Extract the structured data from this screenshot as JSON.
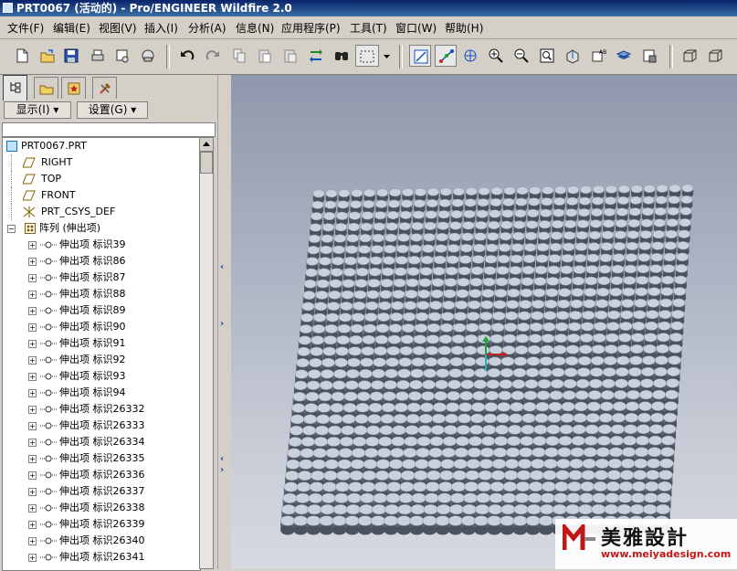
{
  "window": {
    "title": "PRT0067 (活动的) - Pro/ENGINEER Wildfire 2.0"
  },
  "menu": [
    "文件(F)",
    "编辑(E)",
    "视图(V)",
    "插入(I)",
    "分析(A)",
    "信息(N)",
    "应用程序(P)",
    "工具(T)",
    "窗口(W)",
    "帮助(H)"
  ],
  "toolbar_icons": [
    "new-icon",
    "open-icon",
    "save-icon",
    "print-icon",
    "send-icon",
    "mail-icon",
    "undo-icon",
    "redo-icon",
    "copy-icon",
    "paste-icon",
    "paste-special-icon",
    "regenerate-icon",
    "find-icon",
    "select-box-icon",
    "dropdown-icon",
    "datum-plane-icon",
    "datum-axis-icon",
    "datum-point-icon",
    "zoom-in-icon",
    "zoom-out-icon",
    "refit-icon",
    "orient-icon",
    "saved-views-icon",
    "layers-icon",
    "model-setup-icon",
    "view-wireframe-icon",
    "view-hidden-icon"
  ],
  "left_tabs": [
    "model-tree-icon",
    "folder-icon",
    "favorites-icon",
    "tools-icon"
  ],
  "dropdowns": {
    "show": "显示(I)",
    "settings": "设置(G)"
  },
  "tree": {
    "root": "PRT0067.PRT",
    "datums": [
      {
        "label": "RIGHT",
        "icon": "datum-plane-icon"
      },
      {
        "label": "TOP",
        "icon": "datum-plane-icon"
      },
      {
        "label": "FRONT",
        "icon": "datum-plane-icon"
      },
      {
        "label": "PRT_CSYS_DEF",
        "icon": "csys-icon"
      }
    ],
    "pattern": "阵列 (伸出项)",
    "items": [
      "伸出项 标识39",
      "伸出项 标识86",
      "伸出项 标识87",
      "伸出项 标识88",
      "伸出项 标识89",
      "伸出项 标识90",
      "伸出项 标识91",
      "伸出项 标识92",
      "伸出项 标识93",
      "伸出项 标识94",
      "伸出项 标识26332",
      "伸出项 标识26333",
      "伸出项 标识26334",
      "伸出项 标识26335",
      "伸出项 标识26336",
      "伸出项 标识26337",
      "伸出项 标识26338",
      "伸出项 标识26339",
      "伸出项 标识26340",
      "伸出项 标识26341"
    ]
  },
  "watermark": {
    "title": "美雅設計",
    "url": "www.meiyadesign.com"
  },
  "colors": {
    "titlebar": "#0a246a",
    "viewport_top": "#8f97ac",
    "viewport_bottom": "#d6d9e0",
    "cylinder": "#c9d2dc"
  }
}
